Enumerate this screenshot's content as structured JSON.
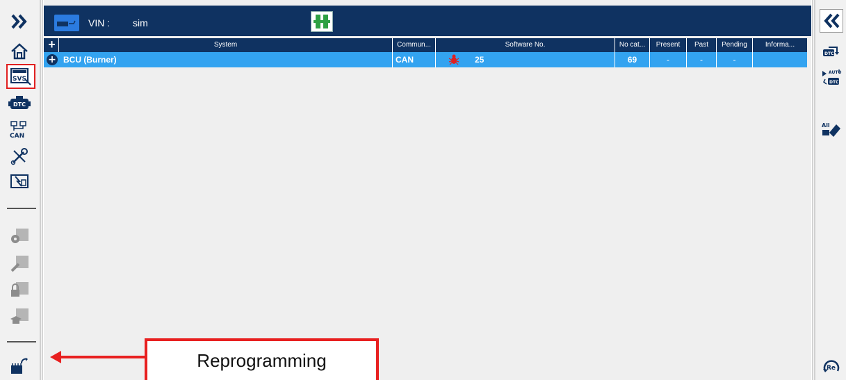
{
  "header": {
    "vin_label": "VIN :",
    "vin_value": "sim",
    "vehicle_icon": "vehicle-icon",
    "connection_icon": "connector-icon"
  },
  "left_toolbar": {
    "items": [
      {
        "icon": "expand-chevrons-icon"
      },
      {
        "icon": "home-icon"
      },
      {
        "icon": "svs-system-scan-icon",
        "selected": true
      },
      {
        "icon": "dtc-icon",
        "label": "DTC"
      },
      {
        "icon": "can-network-icon",
        "label": "CAN"
      },
      {
        "icon": "tools-icon"
      },
      {
        "icon": "flash-monitor-icon"
      },
      {
        "icon": "gear-module-icon",
        "disabled": true
      },
      {
        "icon": "edit-module-icon",
        "disabled": true
      },
      {
        "icon": "lock-module-icon",
        "disabled": true
      },
      {
        "icon": "training-module-icon",
        "disabled": true
      },
      {
        "icon": "reprogramming-icon"
      }
    ]
  },
  "right_toolbar": {
    "items": [
      {
        "icon": "collapse-chevrons-icon"
      },
      {
        "icon": "dtc-refresh-icon",
        "label": "DTC"
      },
      {
        "icon": "auto-dtc-icon",
        "label": "AUTO DTC"
      },
      {
        "icon": "clear-all-dtc-icon",
        "label": "All"
      },
      {
        "icon": "restart-icon",
        "label": "Re"
      }
    ]
  },
  "table": {
    "add_symbol": "+",
    "columns": [
      "System",
      "Commun...",
      "Software No.",
      "No cat...",
      "Present",
      "Past",
      "Pending",
      "Informa..."
    ],
    "rows": [
      {
        "system": "BCU (Burner)",
        "communication": "CAN",
        "status_icon": "red-bug-icon",
        "software_no": "25",
        "no_cat": "69",
        "present": "-",
        "past": "-",
        "pending": "-",
        "information": ""
      }
    ]
  },
  "annotation": {
    "label": "Reprogramming",
    "color": "#e82020"
  },
  "colors": {
    "header_bg": "#0f3261",
    "row_highlight": "#33a3f0",
    "accent_blue": "#2b7be0",
    "connector_green": "#2ea043"
  }
}
